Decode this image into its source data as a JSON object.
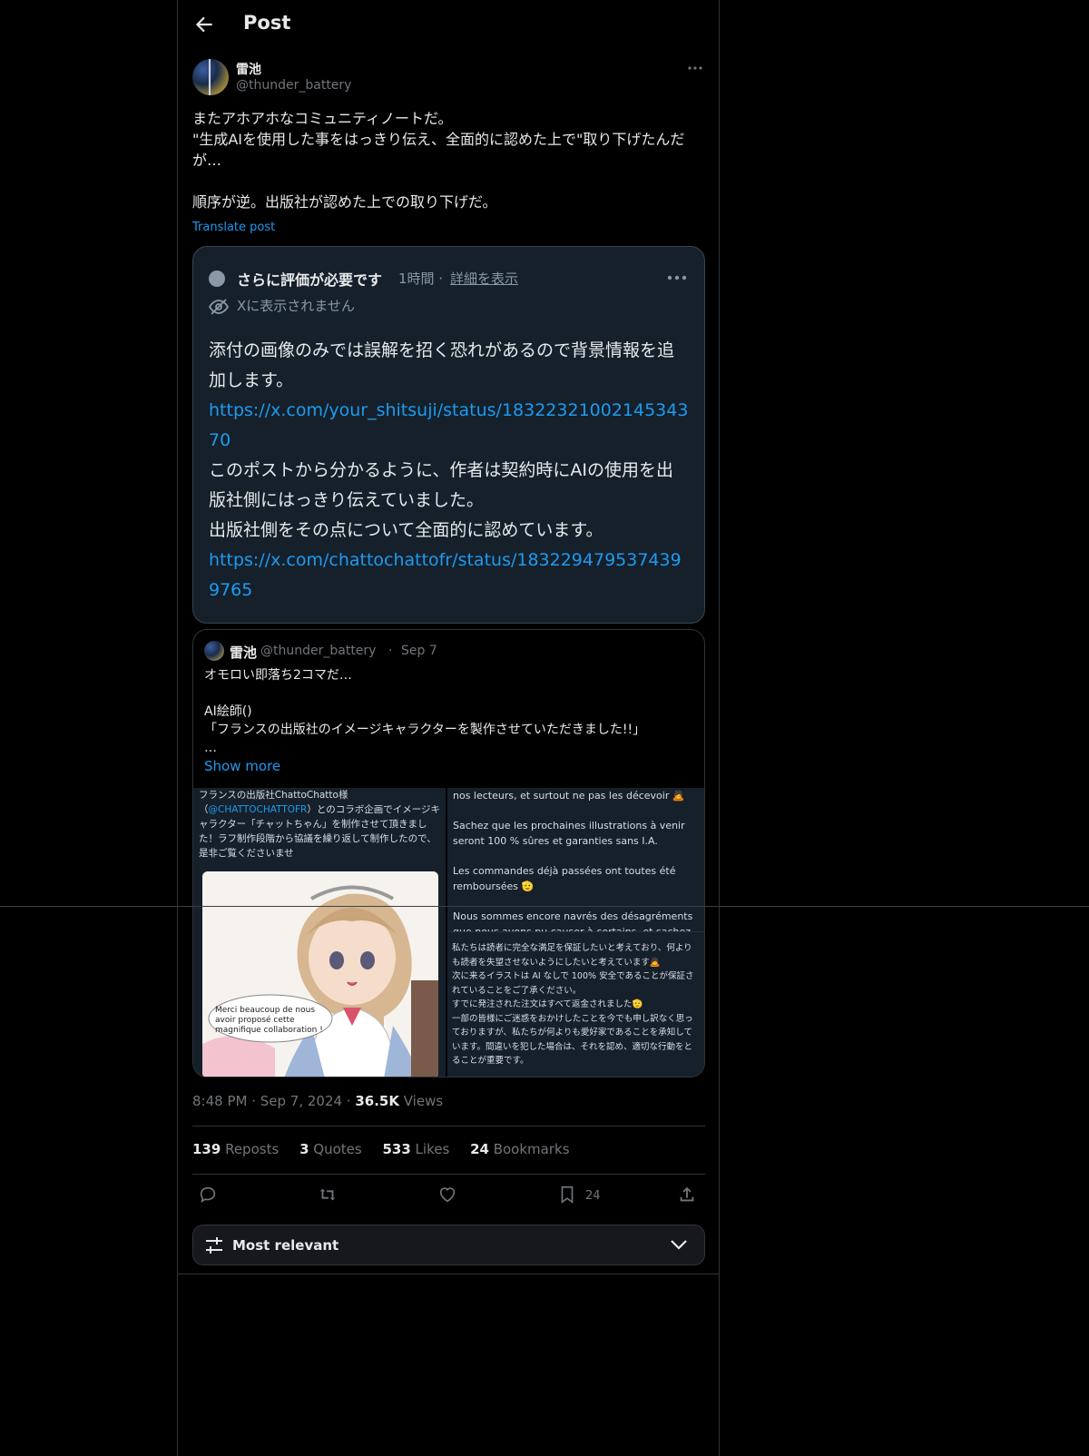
{
  "header": {
    "title": "Post"
  },
  "post": {
    "author_name": "雷池",
    "author_handle": "@thunder_battery",
    "text": "またアホアホなコミュニティノートだ。\n\"生成AIを使用した事をはっきり伝え、全面的に認めた上で\"取り下げたんだが…\n\n順序が逆。出版社が認めた上での取り下げだ。",
    "translate_label": "Translate post",
    "timestamp": "8:48 PM · Sep 7, 2024 · ",
    "views_count": "36.5K",
    "views_label": " Views"
  },
  "community_note": {
    "status": "さらに評価が必要です",
    "time": "1時間 ·",
    "detail_link": "詳細を表示",
    "hidden_label": "Xに表示されません",
    "body_1": "添付の画像のみでは誤解を招く恐れがあるので背景情報を追加します。",
    "link_1": "https://x.com/your_shitsuji/status/1832232100214534370",
    "body_2": "このポストから分かるように、作者は契約時にAIの使用を出版社側にはっきり伝えていました。",
    "body_3": "出版社側をその点について全面的に認めています。",
    "link_2": "https://x.com/chattochattofr/status/1832294795374399765"
  },
  "quote": {
    "name": "雷池",
    "handle": "@thunder_battery",
    "sep": "·",
    "date": "Sep 7",
    "text": "オモロい即落ち2コマだ…\n\nAI絵師()\n「フランスの出版社のイメージキャラクターを製作させていただきました!!」\n…",
    "show_more": "Show more",
    "media_left_text_1": "フランスの出版社ChattoChatto様（",
    "media_left_mention": "@CHATTOCHATTOFR",
    "media_left_text_2": "）とのコラボ企画でイメージキャラクター「チャットちゃん」を制作させて頂きました！ラフ制作段階から協議を繰り返して制作したので、是非ご覧くださいませ",
    "media_bubble": "Merci beaucoup de nous avoir proposé cette magnifique collaboration !",
    "media_right_fr_1": "nos lecteurs, et surtout ne pas les décevoir 🙇",
    "media_right_fr_2": "Sachez que les prochaines illustrations à venir seront 100 % sûres et garanties sans I.A.",
    "media_right_fr_3": "Les commandes déjà passées ont toutes été remboursées 🫡",
    "media_right_fr_4": "Nous sommes encore navrés des désagréments que nous avons pu causer à certains, et sachez que",
    "media_right_jp": "私たちは読者に完全な満足を保証したいと考えており、何よりも読者を失望させないようにしたいと考えています🙇\n次に来るイラストは AI なしで 100% 安全であることが保証されていることをご了承ください。\nすでに発注された注文はすべて返金されました🫡\n一部の皆様にご迷惑をおかけしたことを今でも申し訳なく思っておりますが、私たちが何よりも愛好家であることを承知しています。間違いを犯した場合は、それを認め、適切な行動をとることが重要です。"
  },
  "stats": {
    "reposts_count": "139",
    "reposts_label": " Reposts",
    "quotes_count": "3",
    "quotes_label": " Quotes",
    "likes_count": "533",
    "likes_label": " Likes",
    "bookmarks_count": "24",
    "bookmarks_label": " Bookmarks"
  },
  "actions": {
    "bookmark_count": "24"
  },
  "sort": {
    "label": "Most relevant"
  },
  "colors": {
    "accent": "#1d9bf0",
    "note_bg": "#15202b",
    "muted": "#71767b"
  }
}
